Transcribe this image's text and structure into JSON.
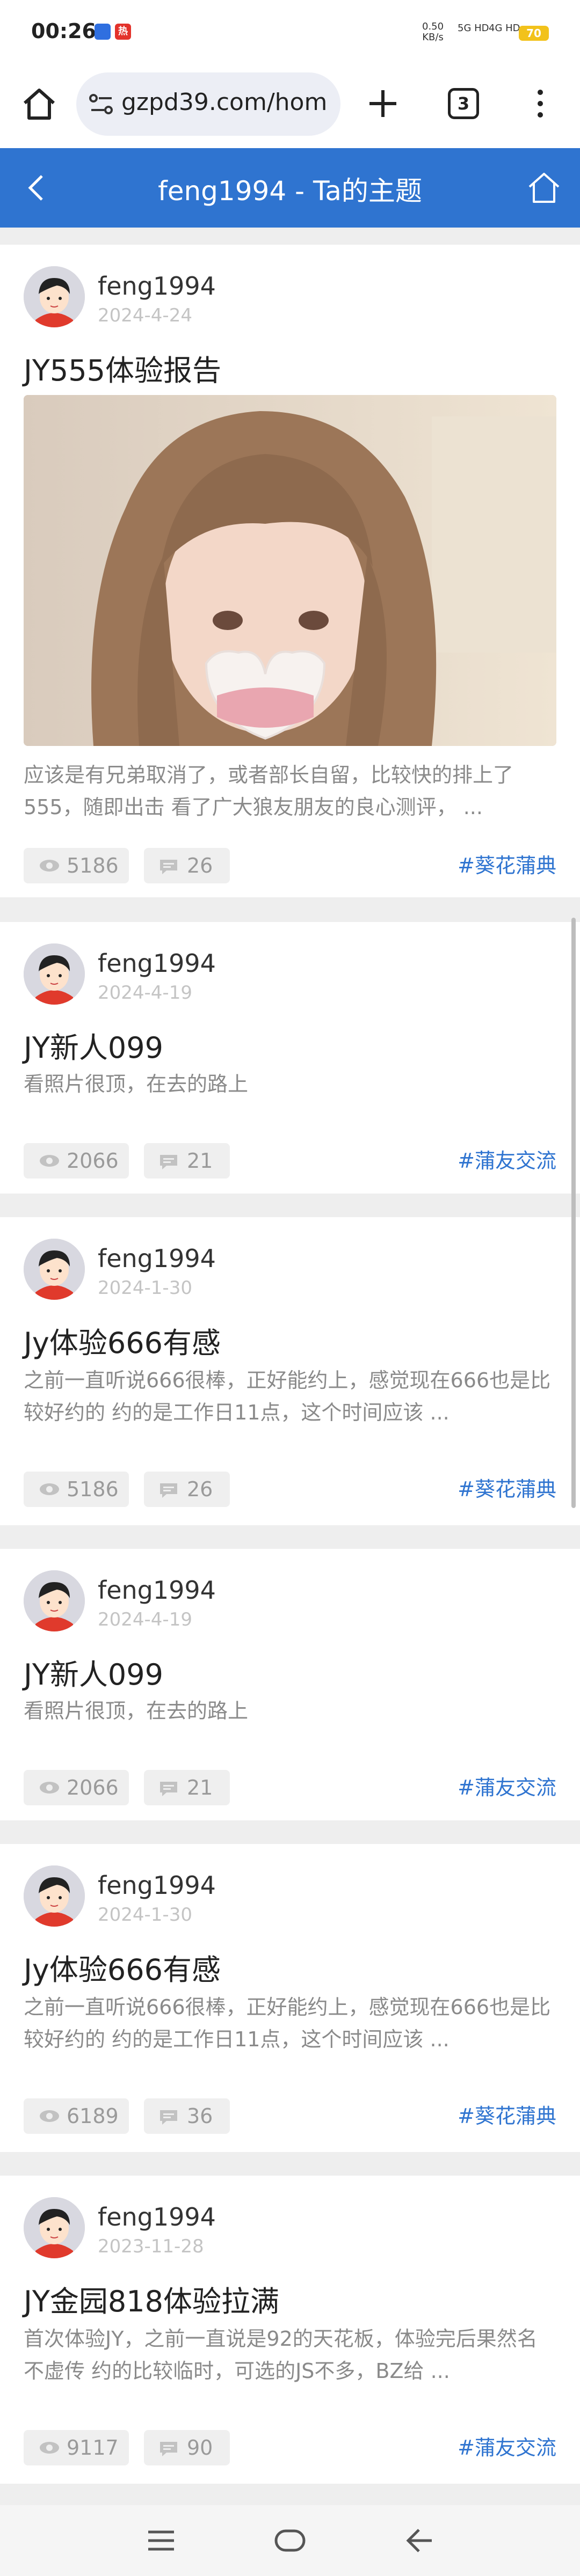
{
  "status": {
    "time": "00:26",
    "app_badge": "热",
    "net_speed": "0.50",
    "net_unit": "KB/s",
    "signal1": "5G HD",
    "signal2": "4G HD",
    "battery": "70"
  },
  "browser": {
    "url": "gzpd39.com/hom",
    "tab_count": "3"
  },
  "header": {
    "title": "feng1994 - Ta的主题"
  },
  "posts": [
    {
      "author": "feng1994",
      "date": "2024-4-24",
      "title": "JY555体验报告",
      "excerpt": "应该是有兄弟取消了，或者部长自留，比较快的排上了555，随即出击 看了广大狼友朋友的良心测评， ...",
      "views": "5186",
      "comments": "26",
      "tag": "#葵花蒲典"
    },
    {
      "author": "feng1994",
      "date": "2024-4-19",
      "title": "JY新人099",
      "excerpt": "看照片很顶，在去的路上",
      "views": "2066",
      "comments": "21",
      "tag": "#蒲友交流"
    },
    {
      "author": "feng1994",
      "date": "2024-1-30",
      "title": "Jy体验666有感",
      "excerpt": "之前一直听说666很棒，正好能约上，感觉现在666也是比较好约的 约的是工作日11点，这个时间应该 ...",
      "views": "5186",
      "comments": "26",
      "tag": "#葵花蒲典"
    },
    {
      "author": "feng1994",
      "date": "2024-4-19",
      "title": "JY新人099",
      "excerpt": "看照片很顶，在去的路上",
      "views": "2066",
      "comments": "21",
      "tag": "#蒲友交流"
    },
    {
      "author": "feng1994",
      "date": "2024-1-30",
      "title": "Jy体验666有感",
      "excerpt": "之前一直听说666很棒，正好能约上，感觉现在666也是比较好约的 约的是工作日11点，这个时间应该 ...",
      "views": "6189",
      "comments": "36",
      "tag": "#葵花蒲典"
    },
    {
      "author": "feng1994",
      "date": "2023-11-28",
      "title": "JY金园818体验拉满",
      "excerpt": "首次体验JY，之前一直说是92的天花板，体验完后果然名不虚传 约的比较临时，可选的JS不多，BZ给 ...",
      "views": "9117",
      "comments": "90",
      "tag": "#蒲友交流"
    }
  ],
  "colors": {
    "accent": "#2f74d0",
    "background": "#eeeeee"
  },
  "icons": [
    "home-icon",
    "site-settings-icon",
    "plus-icon",
    "tabs-icon",
    "more-icon",
    "back-icon",
    "eye-icon",
    "comment-icon",
    "menu-icon",
    "circle-home-icon"
  ]
}
